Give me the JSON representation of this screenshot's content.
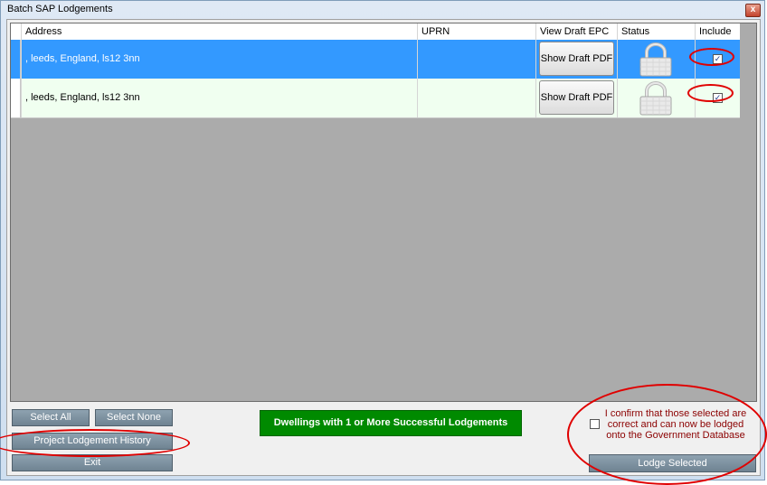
{
  "window": {
    "title": "Batch SAP Lodgements",
    "close_glyph": "x"
  },
  "grid": {
    "columns": [
      "Address",
      "UPRN",
      "View Draft EPC",
      "Status",
      "Include"
    ],
    "rows": [
      {
        "address": ", leeds, England, ls12 3nn",
        "uprn": "",
        "pdf_label": "Show Draft PDF",
        "status_icon": "lock-icon",
        "include_mark": "✓",
        "selected": true
      },
      {
        "address": ", leeds, England, ls12 3nn",
        "uprn": "",
        "pdf_label": "Show Draft PDF",
        "status_icon": "lock-icon",
        "include_mark": "✓",
        "selected": false
      }
    ]
  },
  "buttons": {
    "select_all": "Select All",
    "select_none": "Select None",
    "history": "Project Lodgement History",
    "exit": "Exit",
    "dwellings": "Dwellings with 1 or More Successful Lodgements",
    "lodge": "Lodge Selected"
  },
  "confirm": {
    "text_line1": "I confirm that those selected are",
    "text_line2": "correct and can now be lodged",
    "text_line3": "onto the Government Database"
  },
  "colors": {
    "selected_row": "#3399ff",
    "alt_row": "#f0fff0",
    "green_button": "#008a00",
    "annotation_red": "#e00000"
  }
}
